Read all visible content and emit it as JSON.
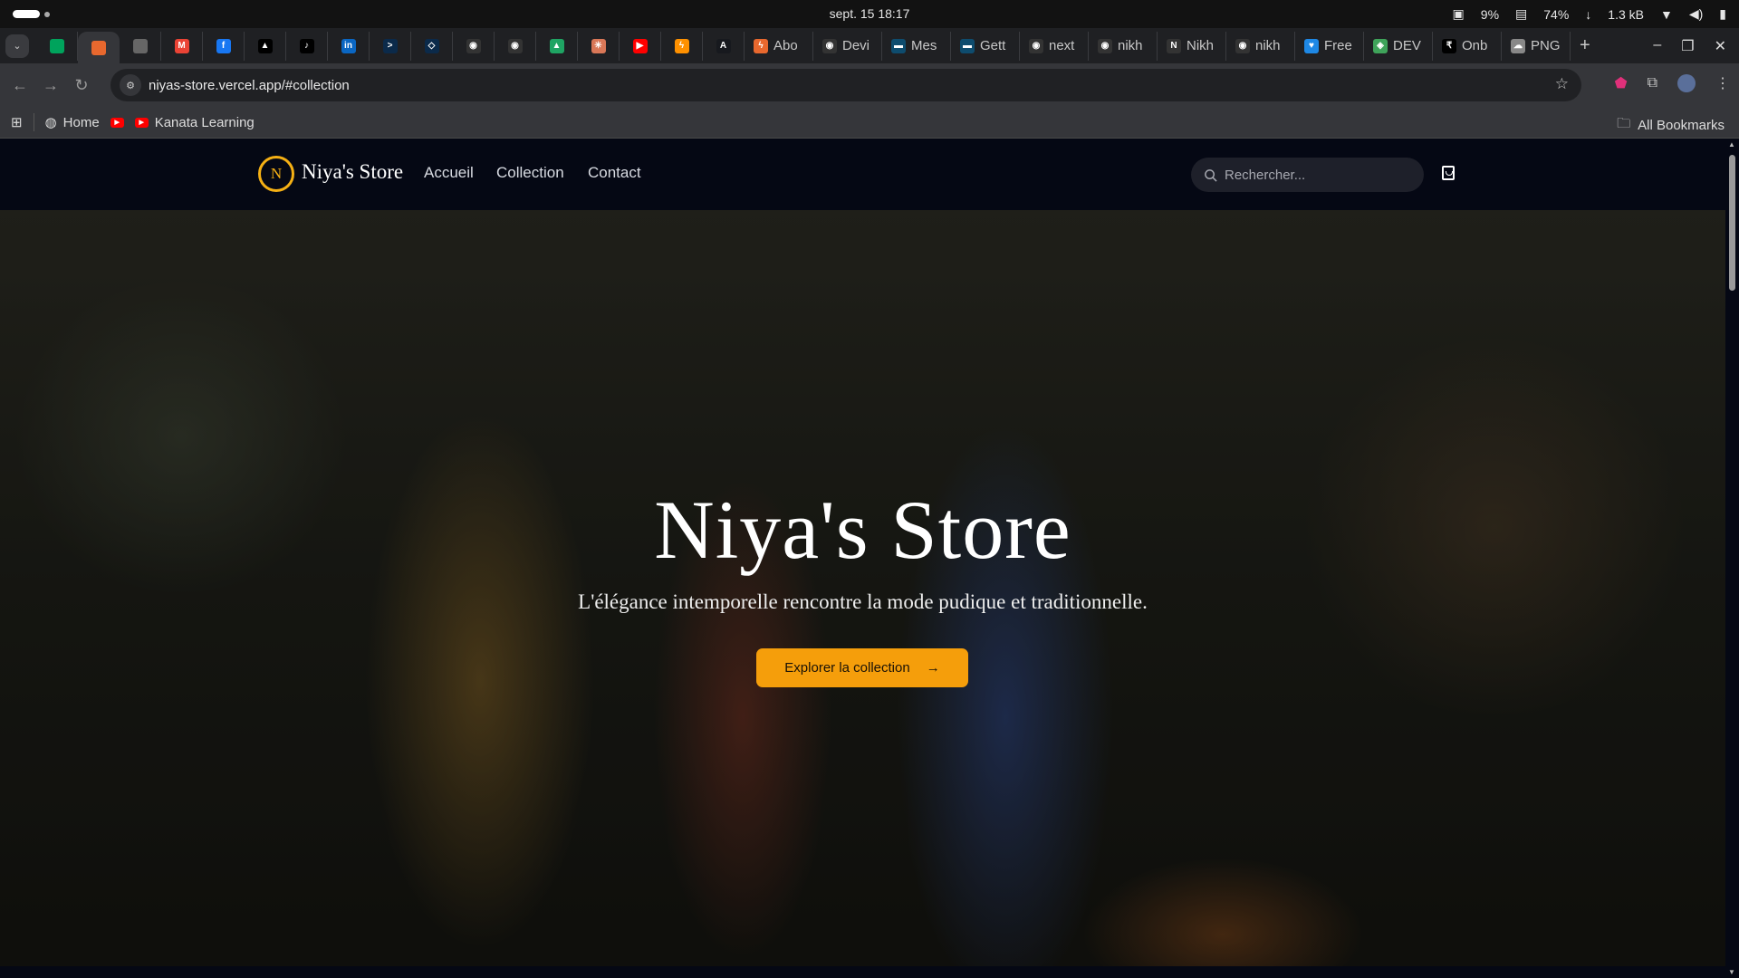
{
  "os": {
    "clock": "sept. 15  18:17",
    "cpu": "9%",
    "mem": "74%",
    "net": "1.3 kB"
  },
  "tabs": [
    {
      "icon": "leaf-icon",
      "color": "#00a35c"
    },
    {
      "icon": "bolt-icon",
      "color": "#e8682e",
      "active": true
    },
    {
      "icon": "openai-icon",
      "color": "#666"
    },
    {
      "icon": "gmail-icon",
      "color": "#ea4335",
      "glyph": "M"
    },
    {
      "icon": "facebook-icon",
      "color": "#1877f2",
      "glyph": "f"
    },
    {
      "icon": "vercel-icon",
      "color": "#000",
      "glyph": "▲"
    },
    {
      "icon": "tiktok-icon",
      "color": "#000",
      "glyph": "♪"
    },
    {
      "icon": "linkedin-icon",
      "color": "#0a66c2",
      "glyph": "in"
    },
    {
      "icon": "terminal-icon",
      "color": "#0b2a4a",
      "glyph": ">"
    },
    {
      "icon": "cloud-icon",
      "color": "#0b2a4a",
      "glyph": "◇"
    },
    {
      "icon": "github-icon",
      "color": "#333",
      "glyph": "◉"
    },
    {
      "icon": "github-icon",
      "color": "#333",
      "glyph": "◉"
    },
    {
      "icon": "drive-icon",
      "color": "#1fa463",
      "glyph": "▲"
    },
    {
      "icon": "claude-icon",
      "color": "#d97757",
      "glyph": "✳"
    },
    {
      "icon": "youtube-icon",
      "color": "#ff0000",
      "glyph": "▶"
    },
    {
      "icon": "firebase-icon",
      "color": "#ff9100",
      "glyph": "ϟ"
    },
    {
      "icon": "astro-icon",
      "color": "#17191e",
      "glyph": "A"
    }
  ],
  "titled_tabs": [
    {
      "label": "Abo",
      "icon": "bolt-icon",
      "color": "#e8682e",
      "glyph": "ϟ"
    },
    {
      "label": "Devi",
      "icon": "github-icon",
      "color": "#333",
      "glyph": "◉"
    },
    {
      "label": "Mes",
      "icon": "app-icon",
      "color": "#0e4c6e",
      "glyph": "▬"
    },
    {
      "label": "Gett",
      "icon": "app-icon",
      "color": "#0e4c6e",
      "glyph": "▬"
    },
    {
      "label": "next",
      "icon": "github-icon",
      "color": "#333",
      "glyph": "◉"
    },
    {
      "label": "nikh",
      "icon": "github-icon",
      "color": "#333",
      "glyph": "◉"
    },
    {
      "label": "Nikh",
      "icon": "n-icon",
      "color": "#333",
      "glyph": "N"
    },
    {
      "label": "nikh",
      "icon": "github-icon",
      "color": "#333",
      "glyph": "◉"
    },
    {
      "label": "Free",
      "icon": "heart-icon",
      "color": "#1e88e5",
      "glyph": "♥"
    },
    {
      "label": "DEV",
      "icon": "shield-icon",
      "color": "#3fa35a",
      "glyph": "◈"
    },
    {
      "label": "Onb",
      "icon": "rupee-icon",
      "color": "#000",
      "glyph": "₹"
    },
    {
      "label": "PNG",
      "icon": "png-icon",
      "color": "#888",
      "glyph": "☁"
    }
  ],
  "address": {
    "url": "niyas-store.vercel.app/#collection"
  },
  "bookmarks": {
    "home": "Home",
    "kanata": "Kanata Learning",
    "all": "All Bookmarks"
  },
  "site": {
    "logo_letter": "N",
    "brand": "Niya's Store",
    "nav": [
      "Accueil",
      "Collection",
      "Contact"
    ],
    "search_placeholder": "Rechercher...",
    "hero_title": "Niya's Store",
    "hero_subtitle": "L'élégance intemporelle rencontre la mode pudique et traditionnelle.",
    "cta": "Explorer la collection",
    "accent": "#f59e0b"
  }
}
